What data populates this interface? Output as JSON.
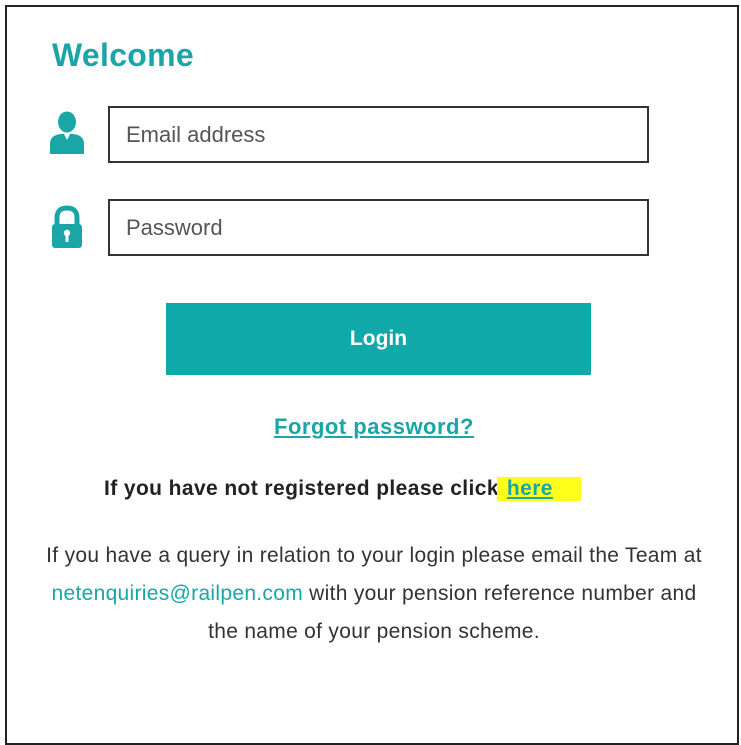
{
  "welcome": {
    "title": "Welcome"
  },
  "form": {
    "email_placeholder": "Email address",
    "email_value": "",
    "password_placeholder": "Password",
    "password_value": "",
    "login_label": "Login",
    "user_icon": "user-icon",
    "lock_icon": "lock-icon"
  },
  "links": {
    "forgot_password": "Forgot password?",
    "register_text": "If you have not registered please click",
    "register_link": "here"
  },
  "help": {
    "text_before": "If you have a query in relation to your login please email the Team at",
    "email": "netenquiries@railpen.com",
    "text_after": "with your pension reference number and the name of your pension scheme."
  },
  "colors": {
    "accent": "#1aa6a6",
    "button": "#0fa9a9",
    "highlight": "#ffff1a"
  }
}
